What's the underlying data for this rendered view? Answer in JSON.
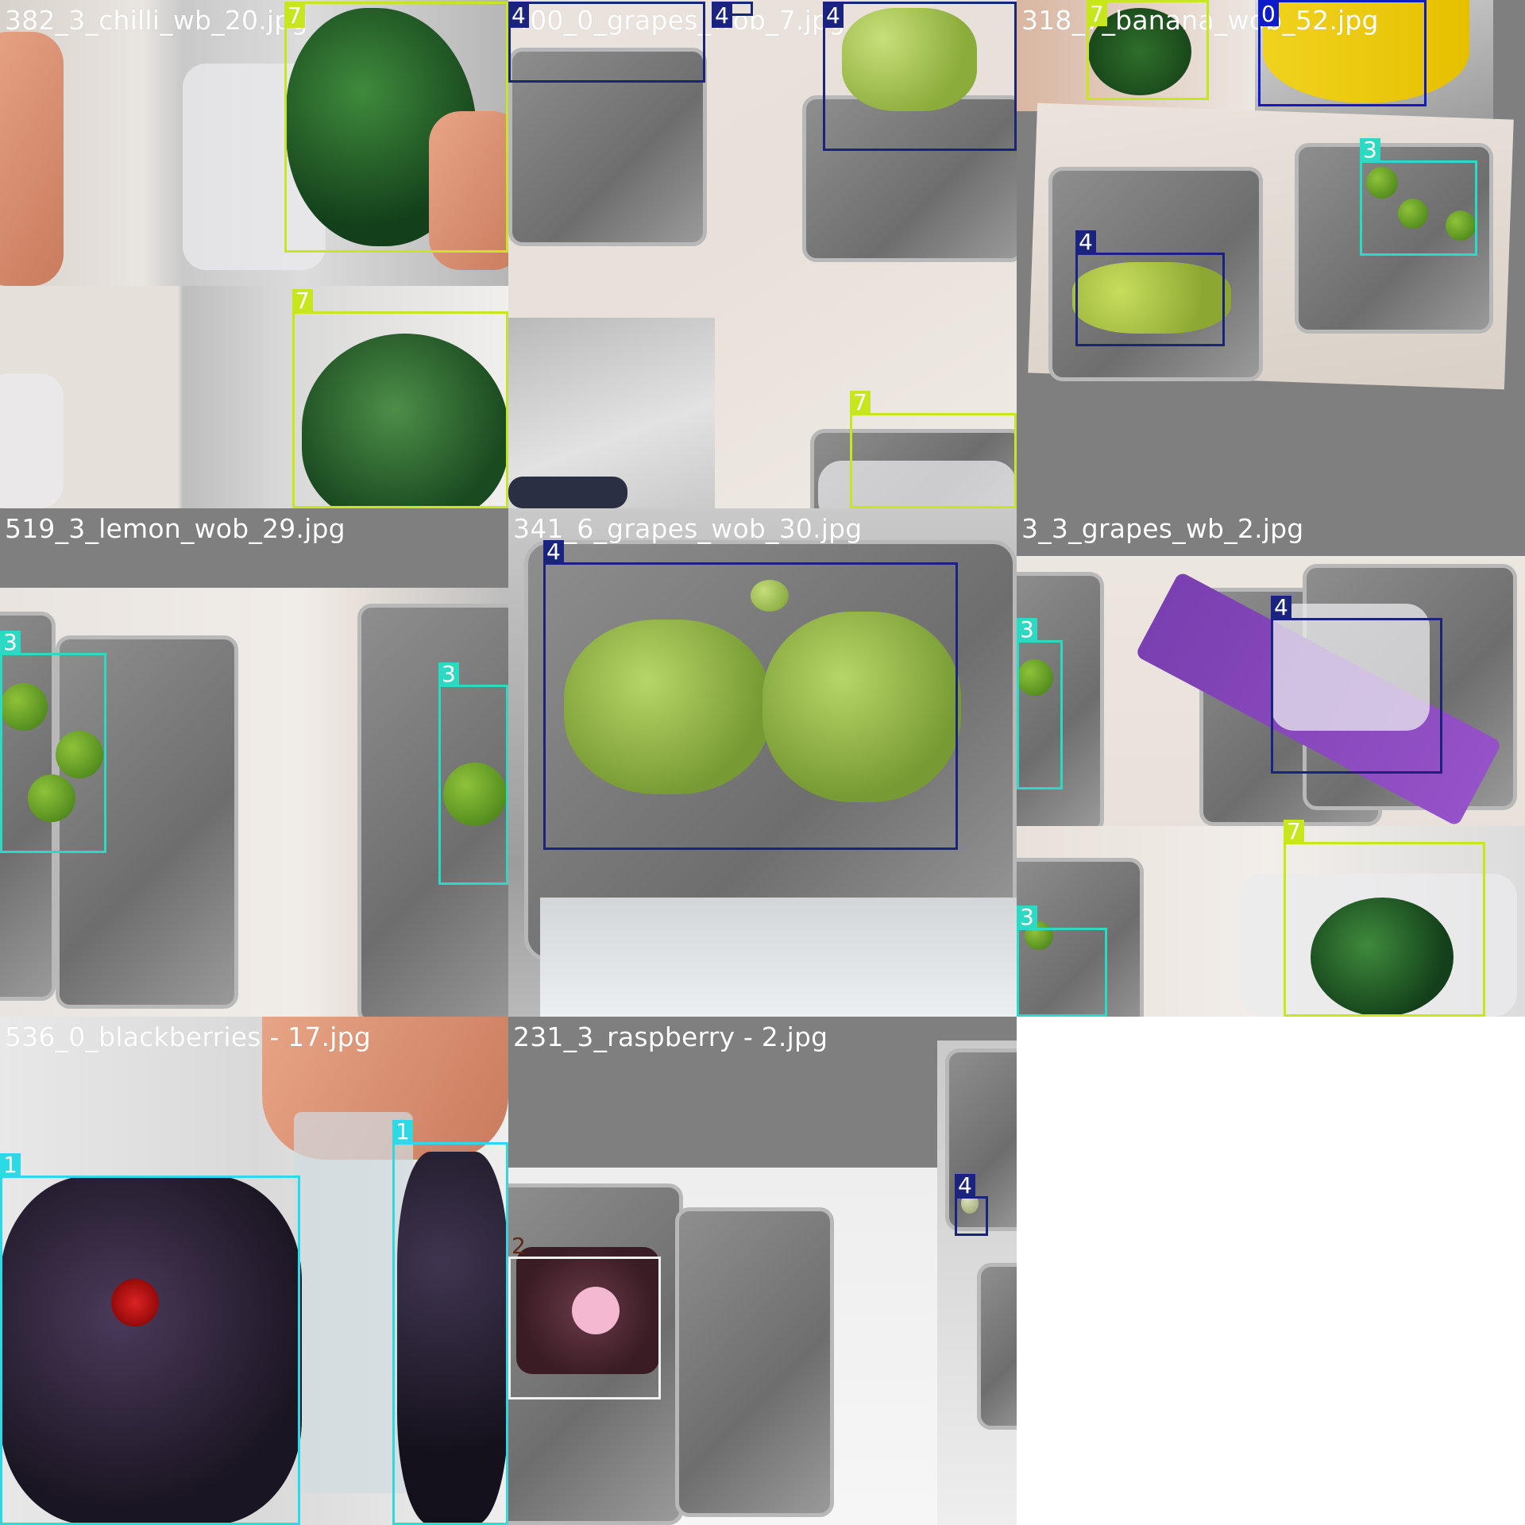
{
  "mosaic": {
    "tiles": [
      {
        "filename": "382_3_chilli_wb_20.jpg",
        "boxes": [
          {
            "class_id": "7",
            "color": "#c8e61e"
          },
          {
            "class_id": "7",
            "color": "#c8e61e"
          }
        ]
      },
      {
        "filename": "400_0_grapes_wob_7.jpg",
        "boxes": [
          {
            "class_id": "4",
            "color": "#1a237e"
          },
          {
            "class_id": "4",
            "color": "#1a237e"
          },
          {
            "class_id": "4",
            "color": "#1a237e"
          },
          {
            "class_id": "7",
            "color": "#c8e61e"
          }
        ]
      },
      {
        "filename": "318_7_banana_wob_52.jpg",
        "boxes": [
          {
            "class_id": "7",
            "color": "#c8e61e"
          },
          {
            "class_id": "0",
            "color": "#0d1cc8"
          },
          {
            "class_id": "3",
            "color": "#2ed9c3"
          },
          {
            "class_id": "4",
            "color": "#1a237e"
          }
        ]
      },
      {
        "filename": "519_3_lemon_wob_29.jpg",
        "boxes": [
          {
            "class_id": "3",
            "color": "#2ed9c3"
          },
          {
            "class_id": "3",
            "color": "#2ed9c3"
          }
        ]
      },
      {
        "filename": "341_6_grapes_wob_30.jpg",
        "boxes": [
          {
            "class_id": "4",
            "color": "#1a237e"
          }
        ]
      },
      {
        "filename": "3_3_grapes_wb_2.jpg",
        "boxes": [
          {
            "class_id": "4",
            "color": "#1a237e"
          },
          {
            "class_id": "3",
            "color": "#2ed9c3"
          },
          {
            "class_id": "7",
            "color": "#c8e61e"
          },
          {
            "class_id": "3",
            "color": "#2ed9c3"
          }
        ]
      },
      {
        "filename": "536_0_blackberries - 17.jpg",
        "boxes": [
          {
            "class_id": "1",
            "color": "#2ed9e6"
          },
          {
            "class_id": "1",
            "color": "#2ed9e6"
          }
        ]
      },
      {
        "filename": "231_3_raspberry - 2.jpg",
        "boxes": [
          {
            "class_id": "2",
            "color": "#f0f0f0"
          },
          {
            "class_id": "4",
            "color": "#1a237e"
          }
        ]
      }
    ]
  }
}
